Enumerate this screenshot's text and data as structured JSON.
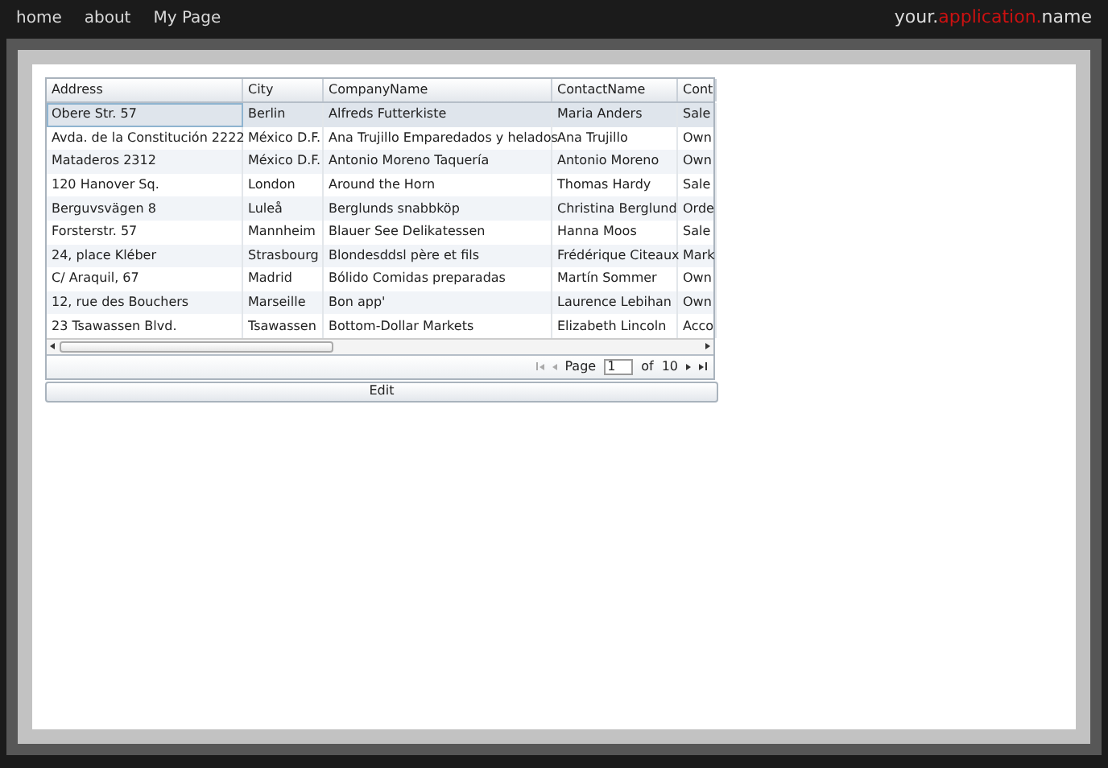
{
  "nav": [
    {
      "label": "home"
    },
    {
      "label": "about"
    },
    {
      "label": "My Page"
    }
  ],
  "brand": [
    {
      "text": "your.",
      "kind": "plain"
    },
    {
      "text": "application.",
      "kind": "accent"
    },
    {
      "text": "name",
      "kind": "plain"
    }
  ],
  "grid": {
    "columns": [
      "Address",
      "City",
      "CompanyName",
      "ContactName",
      "Cont"
    ],
    "rows": [
      {
        "cells": [
          "Obere Str. 57",
          "Berlin",
          "Alfreds Futterkiste",
          "Maria Anders",
          "Sale"
        ],
        "selected": true
      },
      {
        "cells": [
          "Avda. de la Constitución 2222",
          "México D.F.",
          "Ana Trujillo Emparedados y helados",
          "Ana Trujillo",
          "Own"
        ],
        "selected": false
      },
      {
        "cells": [
          "Mataderos  2312",
          "México D.F.",
          "Antonio Moreno Taquería",
          "Antonio Moreno",
          "Own"
        ],
        "selected": false
      },
      {
        "cells": [
          "120 Hanover Sq.",
          "London",
          "Around the Horn",
          "Thomas Hardy",
          "Sale"
        ],
        "selected": false
      },
      {
        "cells": [
          "Berguvsvägen  8",
          "Luleå",
          "Berglunds snabbköp",
          "Christina Berglund",
          "Orde"
        ],
        "selected": false
      },
      {
        "cells": [
          "Forsterstr. 57",
          "Mannheim",
          "Blauer See Delikatessen",
          "Hanna Moos",
          "Sale"
        ],
        "selected": false
      },
      {
        "cells": [
          "24, place Kléber",
          "Strasbourg",
          "Blondesddsl père et fils",
          "Frédérique Citeaux",
          "Mark"
        ],
        "selected": false
      },
      {
        "cells": [
          "C/ Araquil, 67",
          "Madrid",
          "Bólido Comidas preparadas",
          "Martín Sommer",
          "Own"
        ],
        "selected": false
      },
      {
        "cells": [
          "12, rue des Bouchers",
          "Marseille",
          "Bon app'",
          "Laurence Lebihan",
          "Own"
        ],
        "selected": false
      },
      {
        "cells": [
          "23 Tsawassen Blvd.",
          "Tsawassen",
          "Bottom-Dollar Markets",
          "Elizabeth Lincoln",
          "Acco"
        ],
        "selected": false
      }
    ]
  },
  "pager": {
    "page_label": "Page",
    "page": "1",
    "of_label": "of",
    "total": "10"
  },
  "edit_button": "Edit"
}
